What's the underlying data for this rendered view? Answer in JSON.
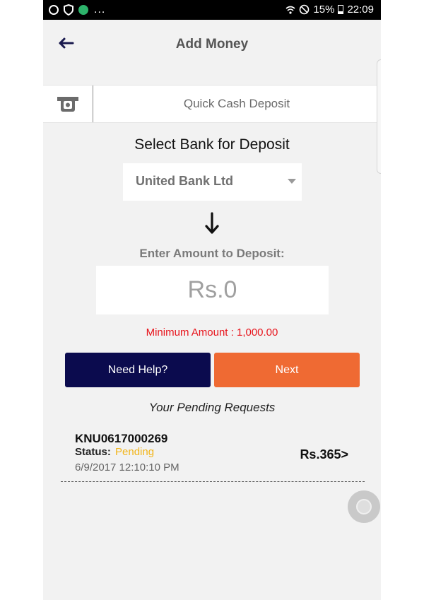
{
  "status_bar": {
    "left_icons": [
      "shield-icon",
      "vpn-icon",
      "globe-icon"
    ],
    "ellipsis": "...",
    "battery_percent": "15%",
    "time": "22:09"
  },
  "header": {
    "title": "Add Money",
    "back_icon": "back-arrow-icon"
  },
  "tab": {
    "icon": "cash-deposit-icon",
    "label": "Quick Cash Deposit"
  },
  "deposit": {
    "section_title": "Select Bank for Deposit",
    "selected_bank": "United Bank Ltd",
    "amount_label": "Enter Amount to Deposit:",
    "amount_placeholder": "Rs.0",
    "minimum_amount": "Minimum Amount : 1,000.00"
  },
  "buttons": {
    "help": "Need Help?",
    "next": "Next"
  },
  "pending": {
    "title": "Your Pending Requests",
    "items": [
      {
        "id": "KNU0617000269",
        "status_label": "Status:",
        "status": "Pending",
        "date": "6/9/2017 12:10:10 PM",
        "amount": "Rs.365>"
      }
    ]
  },
  "colors": {
    "help_button": "#0b0b4e",
    "next_button": "#ef6a33",
    "pending_status": "#f2b51a",
    "minimum_amount": "#e8141c"
  }
}
